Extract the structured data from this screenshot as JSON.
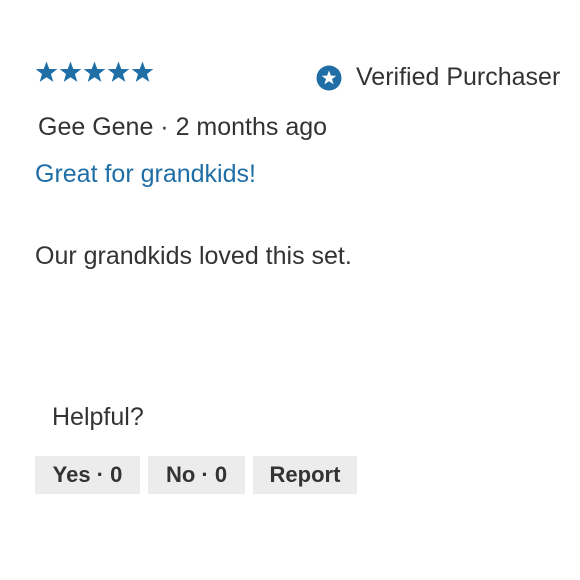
{
  "rating": {
    "stars": 5,
    "max": 5,
    "color": "#1f6ea6",
    "icon": "star-icon"
  },
  "verified": {
    "icon": "verified-star-badge-icon",
    "label": "Verified Purchaser",
    "color": "#1f6ea6"
  },
  "review": {
    "author": "Gee Gene",
    "separator": "·",
    "time_ago": "2 months ago",
    "meta_line": "Gee Gene · 2 months ago",
    "title": "Great for grandkids!",
    "body": "Our grandkids loved this set."
  },
  "feedback": {
    "prompt": "Helpful?",
    "yes_label": "Yes · 0",
    "no_label": "No · 0",
    "report_label": "Report",
    "yes_count": 0,
    "no_count": 0,
    "button_bg": "#ececec"
  }
}
